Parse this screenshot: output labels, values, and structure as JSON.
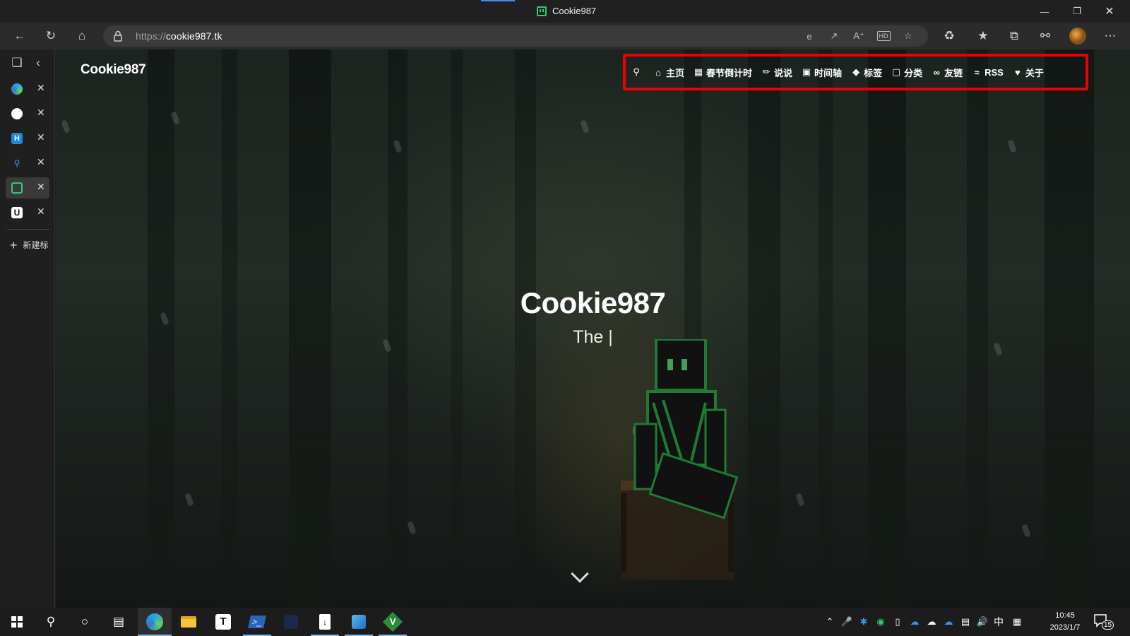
{
  "browser": {
    "window_title": "Cookie987",
    "url_protocol": "https://",
    "url_host": "cookie987.tk"
  },
  "sidebar": {
    "tabs": [
      {
        "icon": "edge-icon",
        "color": "#2ea0e6"
      },
      {
        "icon": "github-icon",
        "color": "#ffffff"
      },
      {
        "icon": "h-logo-icon",
        "color": "#1e88e5"
      },
      {
        "icon": "search-icon",
        "color": "#4a8ef0"
      },
      {
        "icon": "cookie987-favicon-icon",
        "color": "#2ecc71",
        "active": true
      },
      {
        "icon": "u-logo-icon",
        "color": "#ffffff"
      }
    ],
    "new_tab_label": "新建标"
  },
  "site": {
    "logo": "Cookie987",
    "nav": [
      {
        "icon": "home-icon",
        "label": "主页"
      },
      {
        "icon": "calendar-icon",
        "label": "春节倒计时"
      },
      {
        "icon": "comments-icon",
        "label": "说说"
      },
      {
        "icon": "archive-icon",
        "label": "时间轴"
      },
      {
        "icon": "tag-icon",
        "label": "标签"
      },
      {
        "icon": "folder-icon",
        "label": "分类"
      },
      {
        "icon": "link-icon",
        "label": "友链"
      },
      {
        "icon": "rss-icon",
        "label": "RSS"
      },
      {
        "icon": "heart-icon",
        "label": "关于"
      }
    ],
    "hero_title": "Cookie987",
    "hero_subtitle": "The |",
    "highlight_color": "#e00000"
  },
  "taskbar": {
    "ime": "中",
    "time": "10:45",
    "date": "2023/1/7",
    "notification_count": "15"
  }
}
